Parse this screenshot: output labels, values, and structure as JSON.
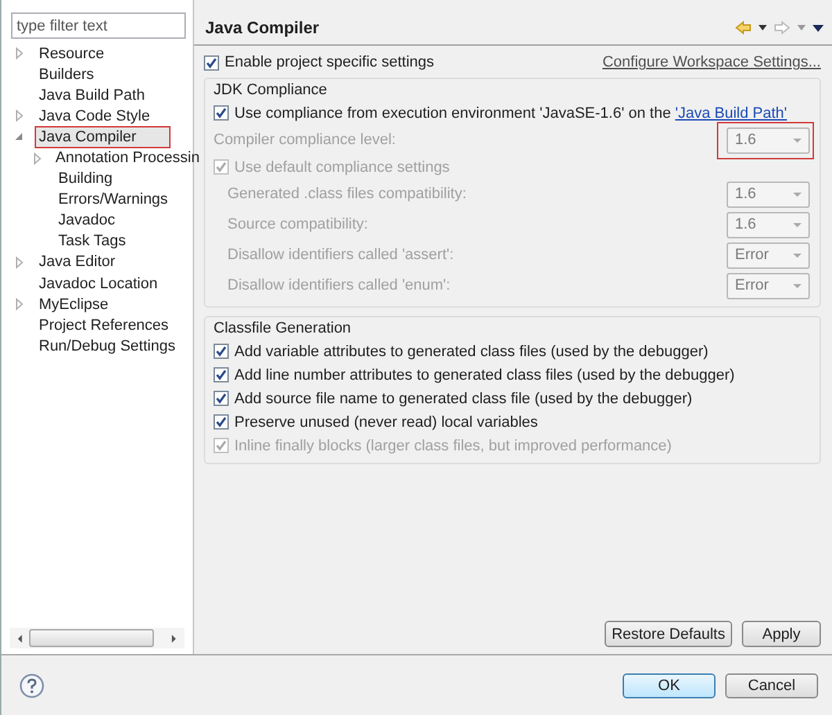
{
  "filter": {
    "placeholder": "type filter text"
  },
  "tree": [
    {
      "label": "Resource",
      "expanded": false,
      "selected": false,
      "highlighted": false
    },
    {
      "label": "Builders",
      "selected": false,
      "highlighted": false
    },
    {
      "label": "Java Build Path",
      "selected": false,
      "highlighted": false
    },
    {
      "label": "Java Code Style",
      "expanded": false,
      "selected": false,
      "highlighted": false
    },
    {
      "label": "Java Compiler",
      "expanded": true,
      "selected": true,
      "highlighted": true,
      "children": [
        {
          "label": "Annotation Processin",
          "expanded": false,
          "selected": false,
          "highlighted": false
        },
        {
          "label": "Building",
          "selected": false,
          "highlighted": false
        },
        {
          "label": "Errors/Warnings",
          "selected": false,
          "highlighted": false
        },
        {
          "label": "Javadoc",
          "selected": false,
          "highlighted": false
        },
        {
          "label": "Task Tags",
          "selected": false,
          "highlighted": false
        }
      ]
    },
    {
      "label": "Java Editor",
      "expanded": false,
      "selected": false,
      "highlighted": false
    },
    {
      "label": "Javadoc Location",
      "selected": false,
      "highlighted": false
    },
    {
      "label": "MyEclipse",
      "expanded": false,
      "selected": false,
      "highlighted": false
    },
    {
      "label": "Project References",
      "selected": false,
      "highlighted": false
    },
    {
      "label": "Run/Debug Settings",
      "selected": false,
      "highlighted": false
    }
  ],
  "page": {
    "title": "Java Compiler",
    "enable": {
      "label": "Enable project specific settings",
      "checked": true
    },
    "configure_link": "Configure Workspace Settings...",
    "groups": [
      {
        "title": "JDK Compliance",
        "rows": [
          {
            "kind": "checkbox",
            "label": "Use compliance from execution environment 'JavaSE-1.6' on the ",
            "link": "'Java Build Path'",
            "checked": true,
            "disabled": false
          },
          {
            "kind": "combo",
            "label": "Compiler compliance level:",
            "value": "1.6",
            "disabled": true,
            "highlighted": true
          },
          {
            "kind": "checkbox",
            "label": "Use default compliance settings",
            "checked": true,
            "disabled": true,
            "children": [
              {
                "kind": "combo",
                "label": "Generated .class files compatibility:",
                "value": "1.6",
                "disabled": true,
                "highlighted": false
              },
              {
                "kind": "combo",
                "label": "Source compatibility:",
                "value": "1.6",
                "disabled": true,
                "highlighted": false
              },
              {
                "kind": "combo",
                "label": "Disallow identifiers called 'assert':",
                "value": "Error",
                "disabled": true,
                "highlighted": false
              },
              {
                "kind": "combo",
                "label": "Disallow identifiers called 'enum':",
                "value": "Error",
                "disabled": true,
                "highlighted": false
              }
            ]
          }
        ]
      },
      {
        "title": "Classfile Generation",
        "rows": [
          {
            "kind": "checkbox",
            "label": "Add variable attributes to generated class files (used by the debugger)",
            "checked": true,
            "disabled": false
          },
          {
            "kind": "checkbox",
            "label": "Add line number attributes to generated class files (used by the debugger)",
            "checked": true,
            "disabled": false
          },
          {
            "kind": "checkbox",
            "label": "Add source file name to generated class file (used by the debugger)",
            "checked": true,
            "disabled": false
          },
          {
            "kind": "checkbox",
            "label": "Preserve unused (never read) local variables",
            "checked": true,
            "disabled": false
          },
          {
            "kind": "checkbox",
            "label": "Inline finally blocks (larger class files, but improved performance)",
            "checked": true,
            "disabled": true
          }
        ]
      }
    ],
    "buttons": [
      {
        "label": "Restore Defaults"
      },
      {
        "label": "Apply"
      }
    ]
  },
  "dialog_buttons": [
    {
      "label": "OK",
      "default": true
    },
    {
      "label": "Cancel",
      "default": false
    }
  ]
}
